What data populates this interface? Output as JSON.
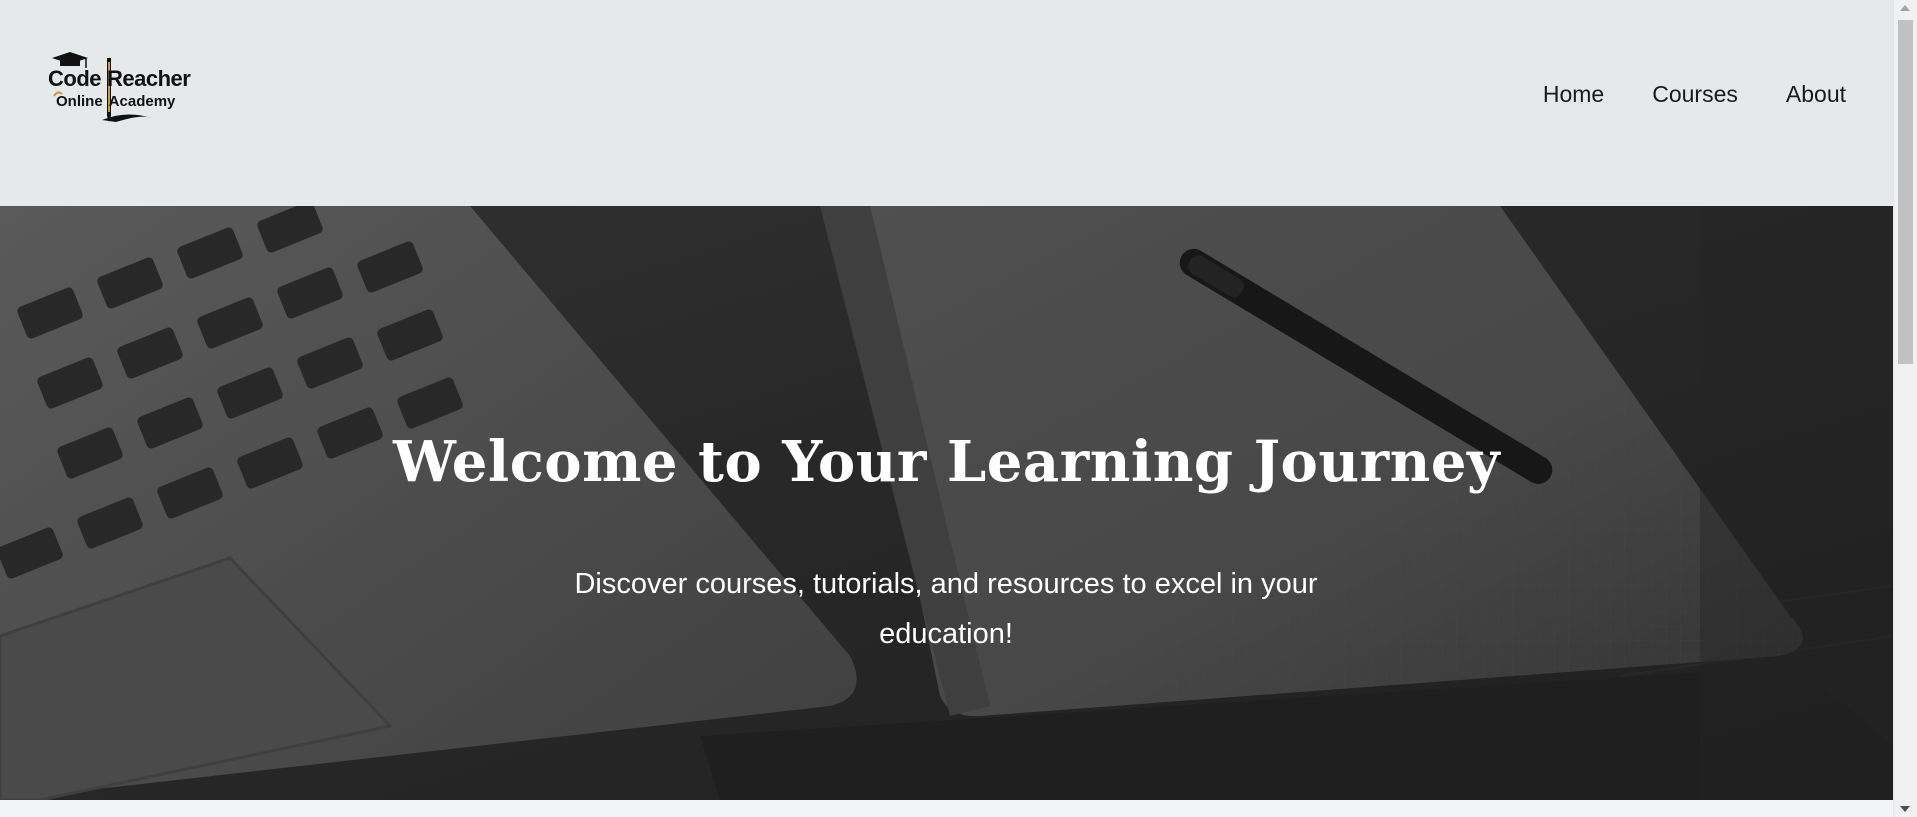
{
  "header": {
    "logo": {
      "line1_left": "Code",
      "line1_right": "Reacher",
      "line2_left": "Online",
      "line2_right": "Academy"
    },
    "nav": [
      {
        "label": "Home"
      },
      {
        "label": "Courses"
      },
      {
        "label": "About"
      }
    ]
  },
  "hero": {
    "title": "Welcome to Your Learning Journey",
    "subtitle": "Discover courses, tutorials, and resources to excel in your education!",
    "background": "laptop-and-notebook-grayscale-photo"
  },
  "colors": {
    "header_bg": "#e6e9ea",
    "hero_overlay": "#2b2b2b",
    "hero_text": "#ffffff",
    "nav_text": "#1a1a1a"
  }
}
